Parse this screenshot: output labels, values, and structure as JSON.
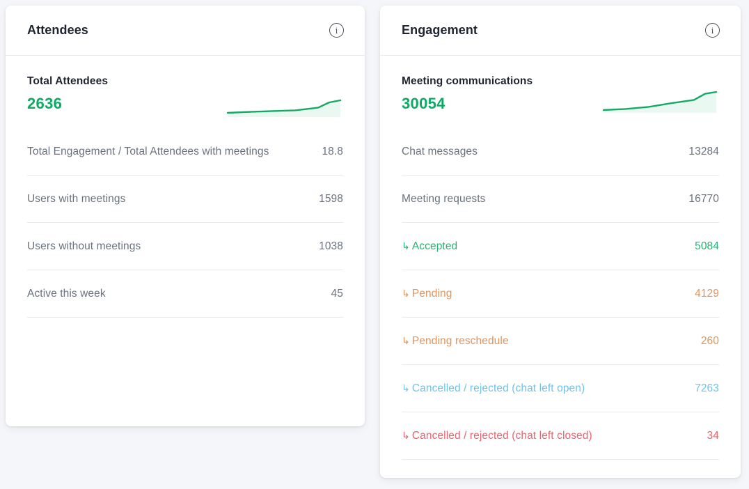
{
  "cards": [
    {
      "title": "Attendees",
      "info_icon": "info-circle-icon",
      "summary": {
        "label": "Total Attendees",
        "value": "2636",
        "value_color": "#0cab64"
      },
      "sparkline": {
        "stroke": "#15a964",
        "fill": "#e9f8f0",
        "points": [
          4,
          40,
          36,
          38.6,
          69,
          37.4,
          101,
          36.4,
          134,
          32.6,
          150,
          25,
          166,
          22
        ]
      },
      "rows": [
        {
          "label": "Total Engagement / Total Attendees with meetings",
          "value": "18.8",
          "color": "#6a7280",
          "arrow": ""
        },
        {
          "label": "Users with meetings",
          "value": "1598",
          "color": "#6a7280",
          "arrow": ""
        },
        {
          "label": "Users without meetings",
          "value": "1038",
          "color": "#6a7280",
          "arrow": ""
        },
        {
          "label": "Active this week",
          "value": "45",
          "color": "#6a7280",
          "arrow": ""
        }
      ]
    },
    {
      "title": "Engagement",
      "info_icon": "info-circle-icon",
      "summary": {
        "label": "Meeting communications",
        "value": "30054",
        "value_color": "#0cab64"
      },
      "sparkline": {
        "stroke": "#15a964",
        "fill": "#e9f8f0",
        "points": [
          4,
          42,
          36,
          40.4,
          69,
          37.4,
          101,
          32.2,
          134,
          27.4,
          150,
          18.6,
          166,
          16
        ]
      },
      "rows": [
        {
          "label": "Chat messages",
          "value": "13284",
          "color": "#6a7280",
          "arrow": ""
        },
        {
          "label": "Meeting requests",
          "value": "16770",
          "color": "#6a7280",
          "arrow": ""
        },
        {
          "label": "Accepted",
          "value": "5084",
          "color": "#22b573",
          "arrow": "↳"
        },
        {
          "label": "Pending",
          "value": "4129",
          "color": "#e0945f",
          "arrow": "↳"
        },
        {
          "label": "Pending reschedule",
          "value": "260",
          "color": "#e0945f",
          "arrow": "↳"
        },
        {
          "label": "Cancelled / rejected (chat left open)",
          "value": "7263",
          "color": "#6ec4e8",
          "arrow": "↳"
        },
        {
          "label": "Cancelled / rejected (chat left closed)",
          "value": "34",
          "color": "#e8636d",
          "arrow": "↳"
        }
      ]
    }
  ]
}
